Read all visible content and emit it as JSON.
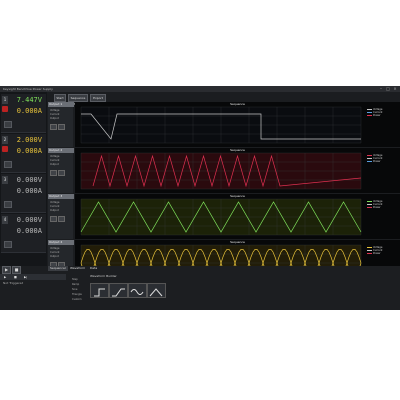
{
  "window": {
    "title": "Keysight BenchVue Power Supply",
    "controls": [
      "–",
      "□",
      "×"
    ]
  },
  "channels": [
    {
      "id": "1",
      "voltage": "7.447V",
      "current": "0.000A",
      "voltage_color": "#7fe05a",
      "current_color": "#e8c33a"
    },
    {
      "id": "2",
      "voltage": "2.000V",
      "current": "0.000A",
      "voltage_color": "#e8c33a",
      "current_color": "#e8c33a"
    },
    {
      "id": "3",
      "voltage": "0.000V",
      "current": "0.000A",
      "voltage_color": "#bbbbbb",
      "current_color": "#bbbbbb"
    },
    {
      "id": "4",
      "voltage": "0.000V",
      "current": "0.000A",
      "voltage_color": "#bbbbbb",
      "current_color": "#bbbbbb"
    }
  ],
  "toolbar": {
    "buttons": [
      "Start",
      "Sequence Setup",
      "Export Data"
    ]
  },
  "rows": [
    {
      "header": "Output 1",
      "lines": [
        "Voltage",
        "Current",
        "Output"
      ],
      "plot_title": "Sequence",
      "legend": [
        "Voltage",
        "Current",
        "Power"
      ],
      "colors": [
        "#c8c8c8",
        "#5aa0e0",
        "#e03050"
      ]
    },
    {
      "header": "Output 2",
      "lines": [
        "Voltage",
        "Current",
        "Output"
      ],
      "plot_title": "Sequence",
      "legend": [
        "Voltage",
        "Current",
        "Power"
      ],
      "colors": [
        "#e03050",
        "#c8c8c8",
        "#5aa0e0"
      ]
    },
    {
      "header": "Output 3",
      "lines": [
        "Voltage",
        "Current",
        "Output"
      ],
      "plot_title": "Sequence",
      "legend": [
        "Voltage",
        "Current",
        "Power"
      ],
      "colors": [
        "#7fe05a",
        "#c8c8c8",
        "#e03050"
      ]
    },
    {
      "header": "Output 4",
      "lines": [
        "Voltage",
        "Current",
        "Output"
      ],
      "plot_title": "Sequence",
      "legend": [
        "Voltage",
        "Current",
        "Power"
      ],
      "colors": [
        "#e8c33a",
        "#c8c8c8",
        "#e03050"
      ]
    }
  ],
  "bottom": {
    "tabs": [
      "Sequencer",
      "Waveform",
      "Data"
    ],
    "status": "Not Triggered",
    "sidebar_items": [
      "Step",
      "Ramp",
      "Sine",
      "Triangle",
      "Custom"
    ],
    "waveform_title": "Waveform Builder"
  },
  "icons": [
    "minimize-icon",
    "maximize-icon",
    "close-icon",
    "play-icon",
    "stop-icon",
    "step-icon",
    "ramp-icon",
    "sine-icon",
    "triangle-icon"
  ]
}
